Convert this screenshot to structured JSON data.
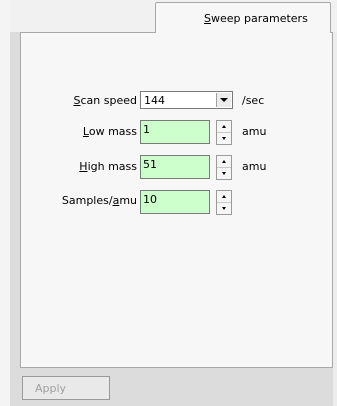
{
  "tab": {
    "label_hotkey": "S",
    "label_rest": "weep parameters"
  },
  "scan_speed": {
    "label_hotkey": "S",
    "label_rest": "can speed",
    "value": "144",
    "unit": "/sec"
  },
  "low_mass": {
    "label_hotkey": "L",
    "label_rest": "ow mass",
    "value": "1",
    "unit": "amu"
  },
  "high_mass": {
    "label_hotkey": "H",
    "label_rest": "igh mass",
    "value": "51",
    "unit": "amu"
  },
  "samples": {
    "label_pre": "Samples/",
    "label_hotkey": "a",
    "label_rest": "mu",
    "value": "10"
  },
  "apply": {
    "label": "Apply"
  },
  "colors": {
    "field_bg": "#ccffcc",
    "disabled_text": "#a0a0a0"
  }
}
